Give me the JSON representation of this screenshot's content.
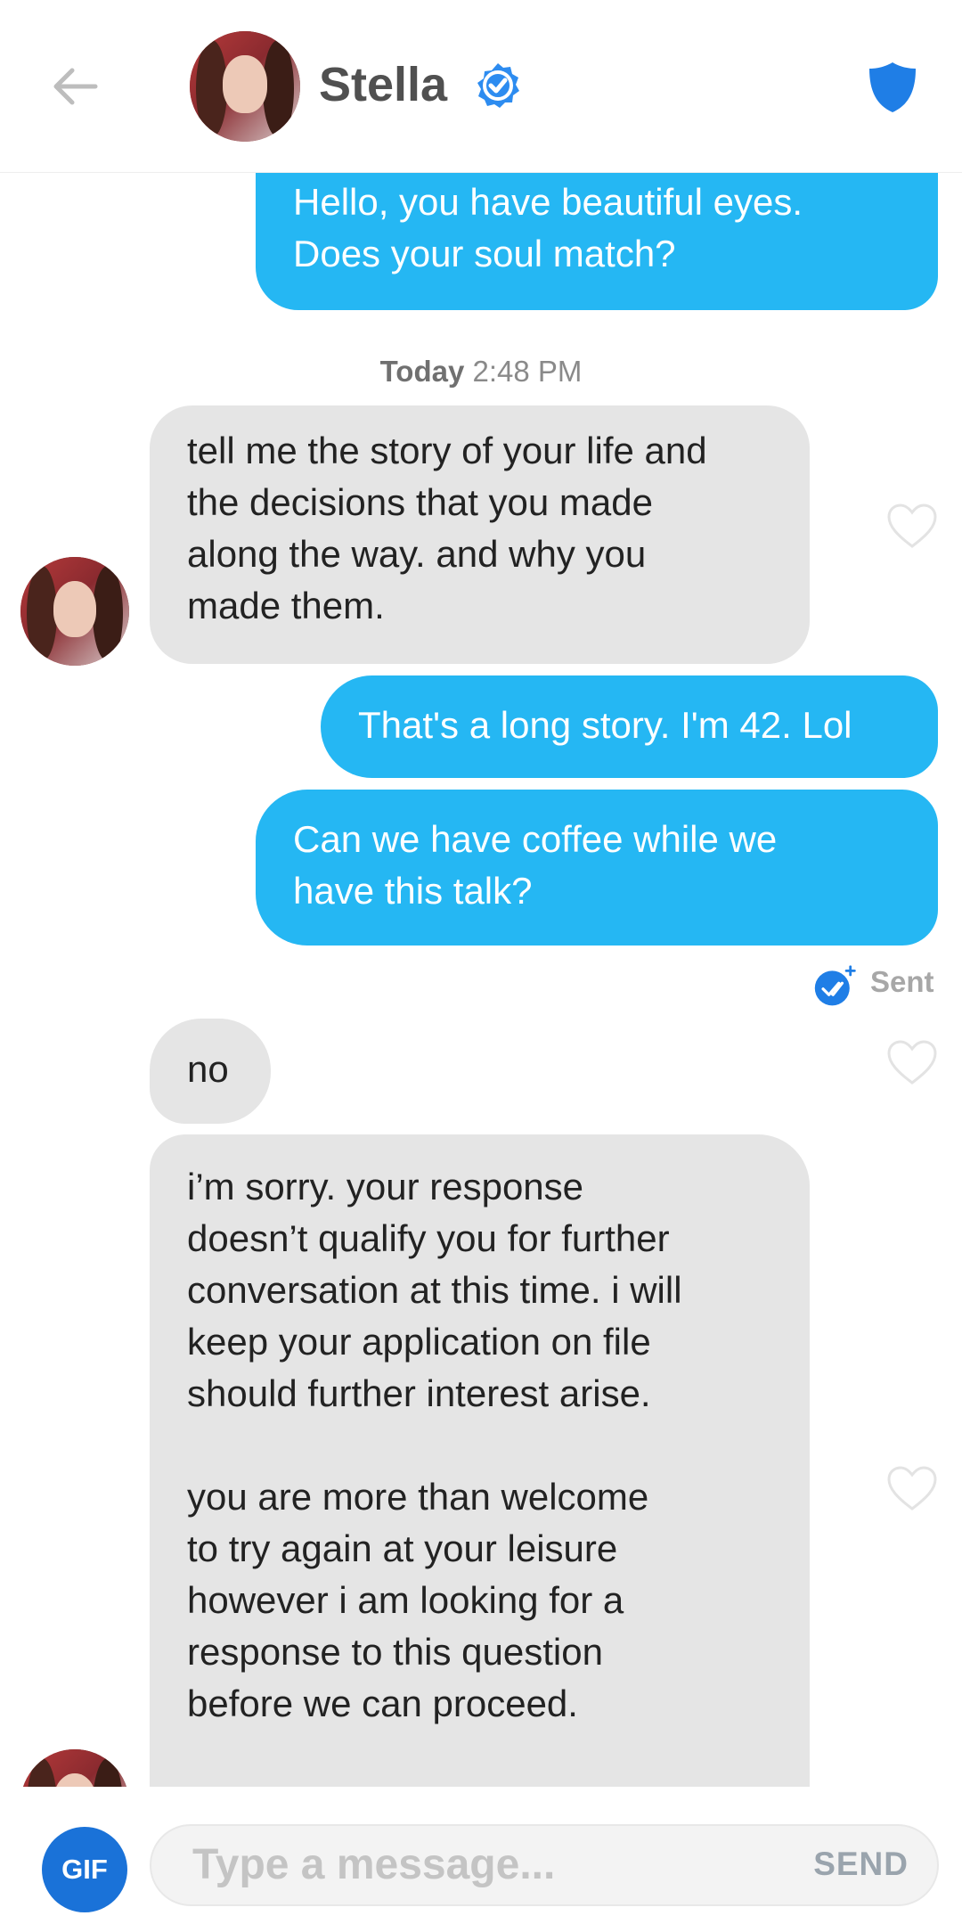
{
  "header": {
    "contact_name": "Stella",
    "verified_icon": "verified-badge-icon",
    "back_icon": "back-arrow-icon",
    "safety_icon": "shield-icon"
  },
  "messages": [
    {
      "id": "m1",
      "direction": "outgoing",
      "text": "Hello, you have beautiful eyes.\nDoes your soul match?"
    },
    {
      "id": "ts1",
      "type": "timestamp",
      "day": "Today",
      "time": "2:48 PM"
    },
    {
      "id": "m2",
      "direction": "incoming",
      "text": "tell me the story of your life and\nthe decisions that you made\nalong the way. and why you\nmade them."
    },
    {
      "id": "m3",
      "direction": "outgoing",
      "text": "That's a long story. I'm 42. Lol"
    },
    {
      "id": "m4",
      "direction": "outgoing",
      "text": "Can we have coffee while we\nhave this talk?"
    },
    {
      "id": "status",
      "type": "status",
      "text": "Sent"
    },
    {
      "id": "m5",
      "direction": "incoming",
      "text": "no"
    },
    {
      "id": "m6",
      "direction": "incoming",
      "text": "i’m sorry. your response\ndoesn’t qualify you for further\nconversation at this time. i will\nkeep your application on file\nshould further interest arise.\n\nyou are more than welcome\nto try again at your leisure\nhowever i am looking for a\nresponse to this question\nbefore we can proceed."
    }
  ],
  "composer": {
    "gif_label": "GIF",
    "placeholder": "Type a message...",
    "send_label": "SEND"
  },
  "colors": {
    "outgoing_bubble": "#25b7f3",
    "incoming_bubble": "#e5e5e5",
    "gif_button": "#1a72d8",
    "verified": "#2d8cf0"
  }
}
